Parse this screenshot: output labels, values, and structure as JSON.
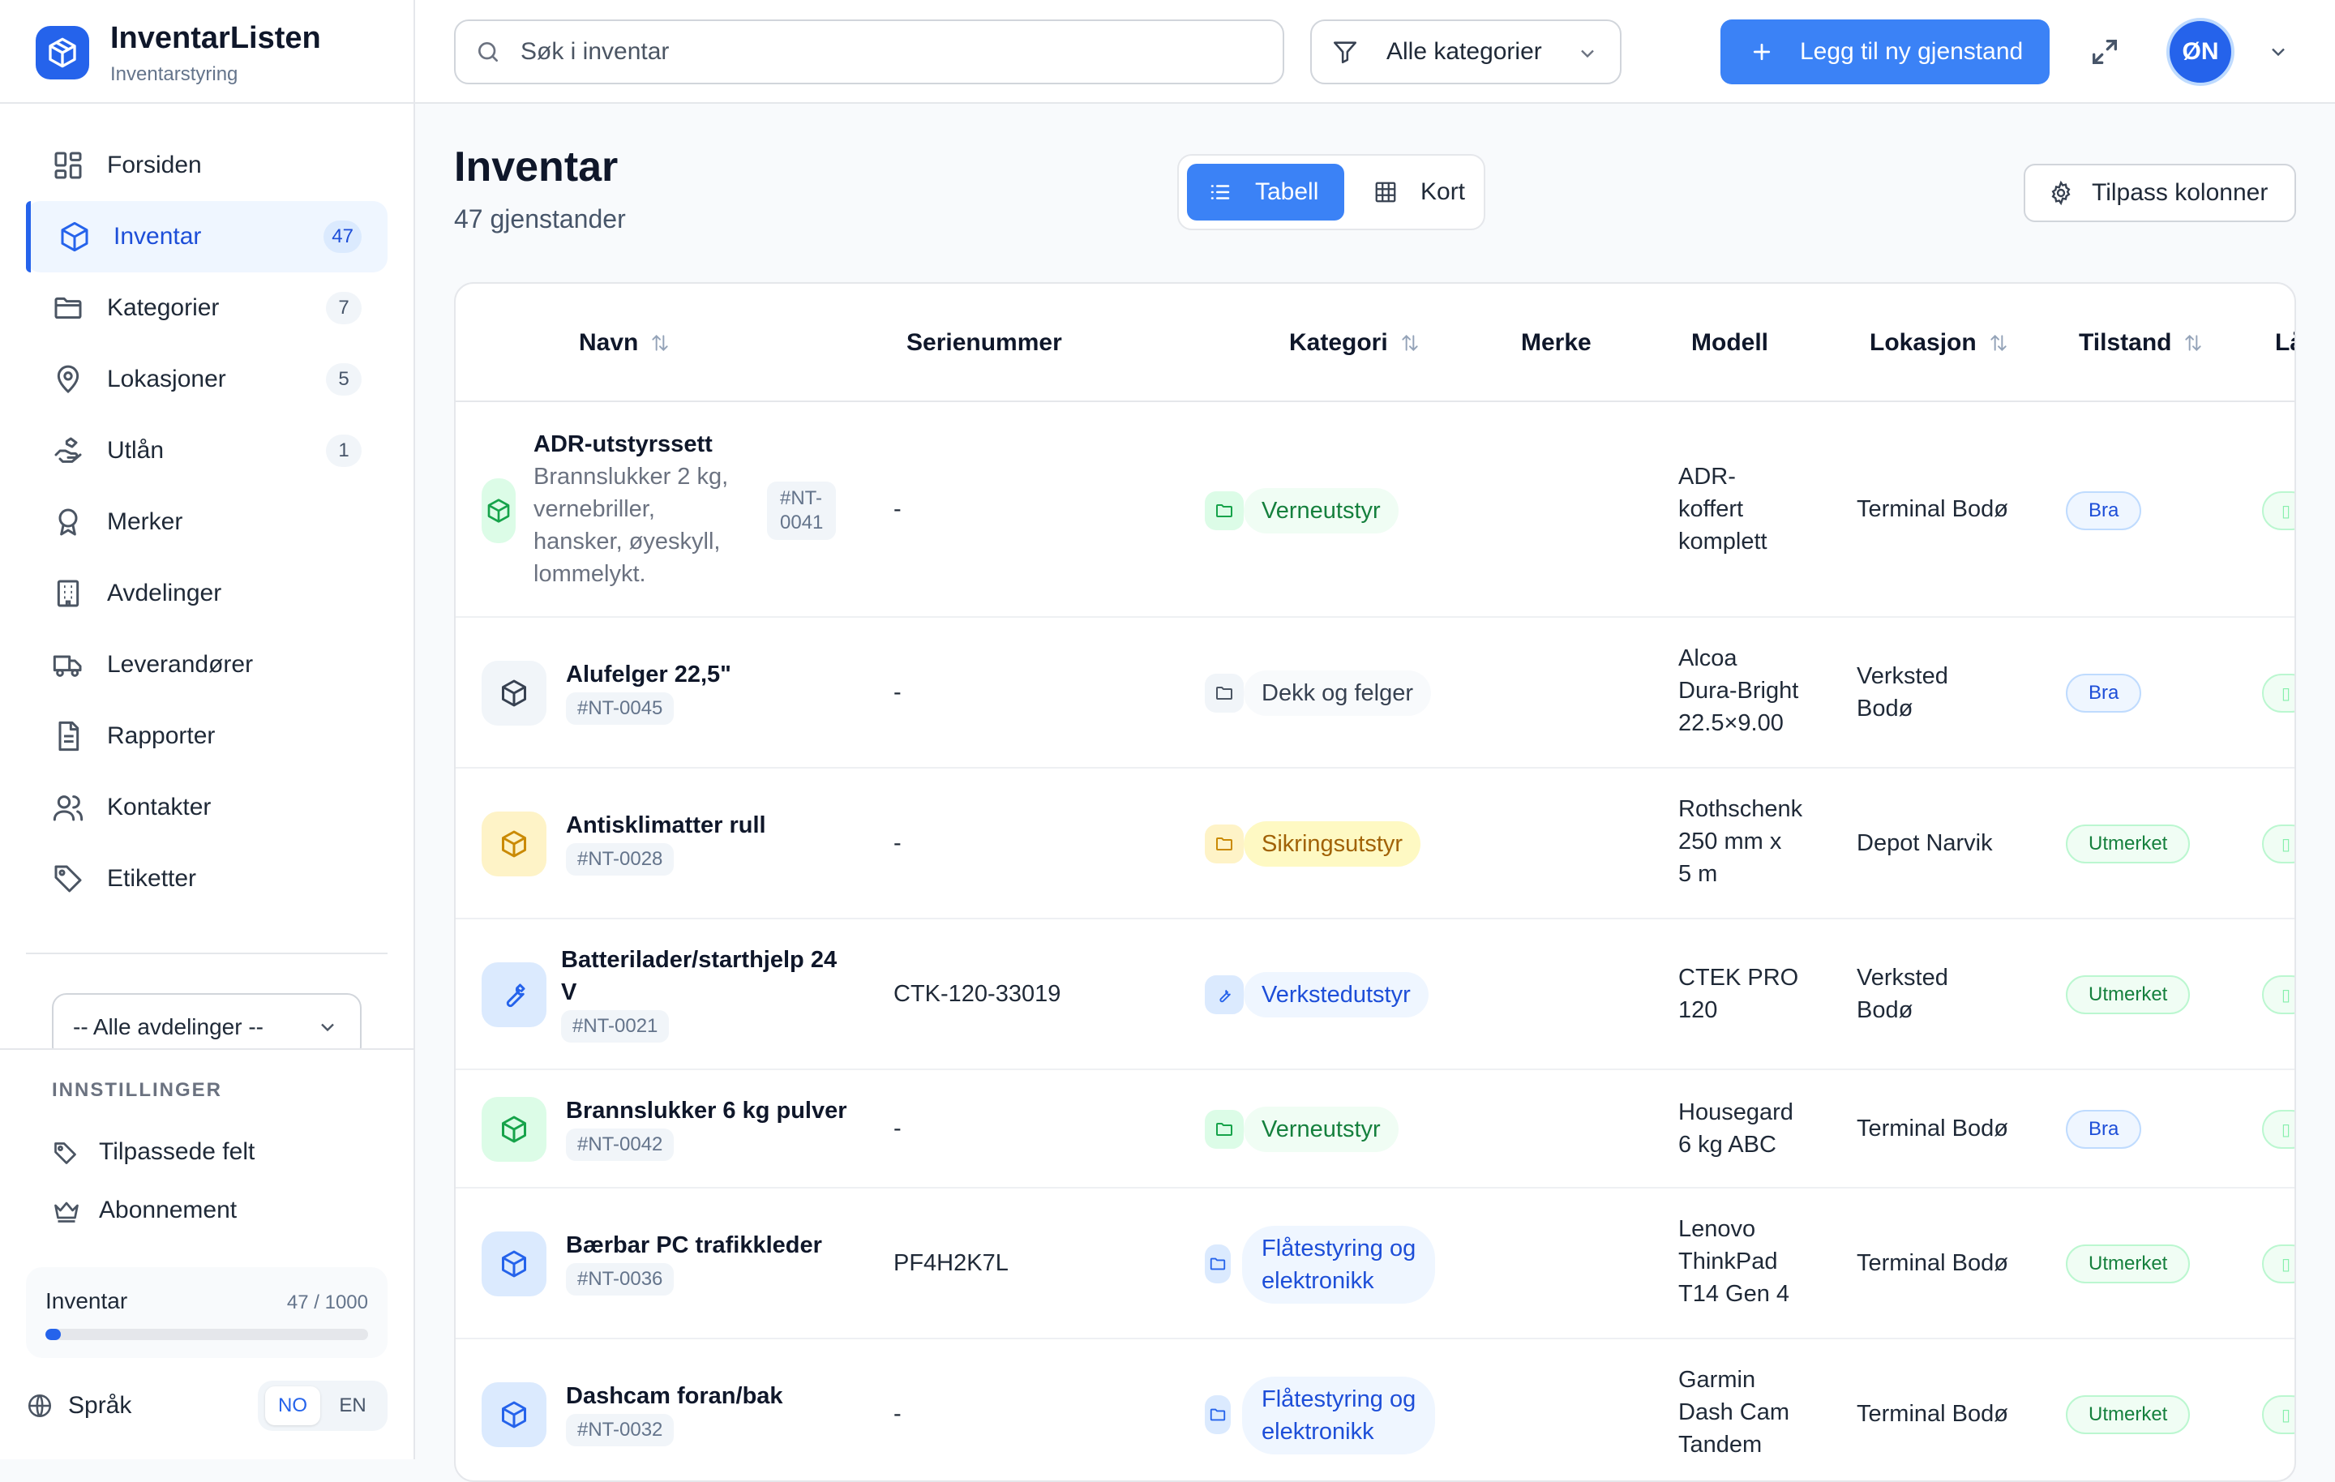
{
  "app": {
    "name": "InventarListen",
    "subtitle": "Inventarstyring"
  },
  "sidebar": {
    "items": [
      {
        "label": "Forsiden",
        "badge": "",
        "icon": "dashboard-icon"
      },
      {
        "label": "Inventar",
        "badge": "47",
        "icon": "box-icon",
        "active": true
      },
      {
        "label": "Kategorier",
        "badge": "7",
        "icon": "folder-icon"
      },
      {
        "label": "Lokasjoner",
        "badge": "5",
        "icon": "map-pin-icon"
      },
      {
        "label": "Utlån",
        "badge": "1",
        "icon": "hand-icon"
      },
      {
        "label": "Merker",
        "badge": "",
        "icon": "award-icon"
      },
      {
        "label": "Avdelinger",
        "badge": "",
        "icon": "building-icon"
      },
      {
        "label": "Leverandører",
        "badge": "",
        "icon": "truck-icon"
      },
      {
        "label": "Rapporter",
        "badge": "",
        "icon": "document-icon"
      },
      {
        "label": "Kontakter",
        "badge": "",
        "icon": "users-icon"
      },
      {
        "label": "Etiketter",
        "badge": "",
        "icon": "tag-icon"
      }
    ],
    "department_select": "-- Alle avdelinger --",
    "settings": {
      "title": "INNSTILLINGER",
      "custom_fields": "Tilpassede felt",
      "subscription": "Abonnement"
    },
    "usage": {
      "label": "Inventar",
      "count": "47 / 1000",
      "fraction": 0.047
    },
    "language": {
      "label": "Språk",
      "options": [
        "NO",
        "EN"
      ],
      "selected": "NO"
    }
  },
  "topbar": {
    "search_placeholder": "Søk i inventar",
    "category_filter": "Alle kategorier",
    "add_button": "Legg til ny gjenstand",
    "avatar_initials": "ØN"
  },
  "page": {
    "title": "Inventar",
    "subtitle": "47 gjenstander",
    "view_table": "Tabell",
    "view_cards": "Kort",
    "customize_columns": "Tilpass kolonner"
  },
  "table": {
    "headers": {
      "name": "Navn",
      "serial": "Serienummer",
      "category": "Kategori",
      "brand": "Merke",
      "model": "Modell",
      "location": "Lokasjon",
      "condition": "Tilstand",
      "cut": "Lå"
    },
    "rows": [
      {
        "name": "ADR-utstyrssett",
        "description": [
          "Brannslukker 2 kg,",
          "vernebriller,",
          "hansker, øyeskyll,",
          "lommelykt."
        ],
        "code": [
          "#NT-",
          "0041"
        ],
        "serial": "-",
        "category": "Verneutstyr",
        "brand": "",
        "model": [
          "ADR-",
          "koffert",
          "komplett"
        ],
        "location": [
          "Terminal Bodø"
        ],
        "condition": "Bra"
      },
      {
        "name": "Alufelger 22,5\"",
        "code": "#NT-0045",
        "serial": "-",
        "category": "Dekk og felger",
        "brand": "",
        "model": [
          "Alcoa",
          "Dura-Bright",
          "22.5×9.00"
        ],
        "location": [
          "Verksted",
          "Bodø"
        ],
        "condition": "Bra"
      },
      {
        "name": "Antisklimatter rull",
        "code": "#NT-0028",
        "serial": "-",
        "category": "Sikringsutstyr",
        "brand": "",
        "model": [
          "Rothschenk",
          "250 mm x",
          "5 m"
        ],
        "location": [
          "Depot Narvik"
        ],
        "condition": "Utmerket"
      },
      {
        "name_lines": [
          "Batterilader/starthjelp 24",
          "V"
        ],
        "code": "#NT-0021",
        "serial": "CTK-120-33019",
        "category": "Verkstedutstyr",
        "brand": "",
        "model": [
          "CTEK PRO",
          "120"
        ],
        "location": [
          "Verksted",
          "Bodø"
        ],
        "condition": "Utmerket"
      },
      {
        "name": "Brannslukker 6 kg pulver",
        "code": "#NT-0042",
        "serial": "-",
        "category": "Verneutstyr",
        "brand": "",
        "model": [
          "Housegard",
          "6 kg ABC"
        ],
        "location": [
          "Terminal Bodø"
        ],
        "condition": "Bra"
      },
      {
        "name": "Bærbar PC trafikkleder",
        "code": "#NT-0036",
        "serial": "PF4H2K7L",
        "category_lines": [
          "Flåtestyring og",
          "elektronikk"
        ],
        "brand": "",
        "model": [
          "Lenovo",
          "ThinkPad",
          "T14 Gen 4"
        ],
        "location": [
          "Terminal Bodø"
        ],
        "condition": "Utmerket"
      },
      {
        "name": "Dashcam foran/bak",
        "code": "#NT-0032",
        "serial": "-",
        "category_lines": [
          "Flåtestyring og",
          "elektronikk"
        ],
        "brand": "",
        "model": [
          "Garmin",
          "Dash Cam",
          "Tandem"
        ],
        "location": [
          "Terminal Bodø"
        ],
        "condition": "Utmerket"
      }
    ]
  },
  "colors": {
    "accent": "#3b82f6",
    "accent_dark": "#2563eb",
    "success": "#16a34a",
    "warning": "#ca8a04"
  }
}
